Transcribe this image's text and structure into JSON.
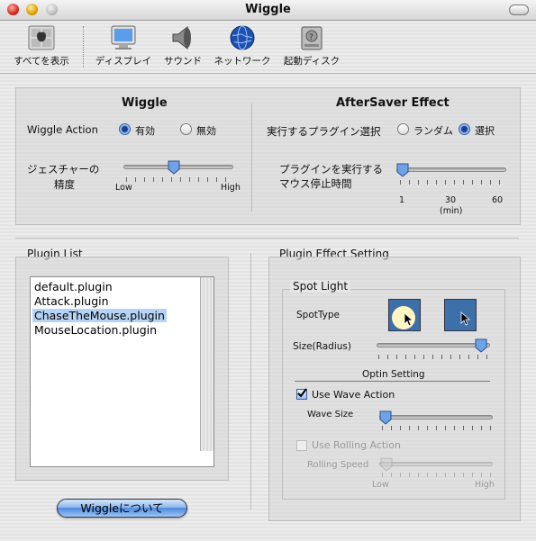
{
  "window": {
    "title": "Wiggle"
  },
  "toolbar": {
    "items": [
      {
        "label": "すべてを表示",
        "icon": "apple-icon"
      },
      {
        "label": "ディスプレイ",
        "icon": "display-icon"
      },
      {
        "label": "サウンド",
        "icon": "speaker-icon"
      },
      {
        "label": "ネットワーク",
        "icon": "globe-icon"
      },
      {
        "label": "起動ディスク",
        "icon": "disk-icon"
      }
    ]
  },
  "wiggle": {
    "title": "Wiggle",
    "action_label": "Wiggle Action",
    "opt_on": "有効",
    "opt_off": "無効",
    "selected": "有効",
    "gesture_label_1": "ジェスチャーの",
    "gesture_label_2": "精度",
    "slider_low": "Low",
    "slider_high": "High",
    "gesture_level": 0.45
  },
  "aftersaver": {
    "title": "AfterSaver Effect",
    "plugin_select_label": "実行するプラグイン選択",
    "opt_random": "ランダム",
    "opt_select": "選択",
    "selected": "選択",
    "idle_label_1": "プラグインを実行する",
    "idle_label_2": "マウス停止時間",
    "tick_1": "1",
    "tick_30": "30",
    "tick_60": "60",
    "unit": "(min)",
    "idle_minutes": 1
  },
  "plugin_list": {
    "title": "Plugin List",
    "items": [
      "default.plugin",
      "Attack.plugin",
      "ChaseTheMouse.plugin",
      "MouseLocation.plugin"
    ],
    "selected_index": 2
  },
  "effect": {
    "title": "Plugin Effect Setting",
    "spot_light": "Spot Light",
    "spot_type_label": "SpotType",
    "size_label": "Size(Radius)",
    "size_level": 0.97,
    "option_setting": "Optin Setting",
    "wave_action_label": "Use Wave Action",
    "wave_action_checked": true,
    "wave_size_label": "Wave Size",
    "wave_level": 0.0,
    "rolling_action_label": "Use Rolling Action",
    "rolling_action_checked": false,
    "rolling_speed_label": "Rolling Speed",
    "rolling_low": "Low",
    "rolling_high": "High"
  },
  "about_button": {
    "label": "Wiggleについて"
  },
  "colors": {
    "accent": "#3a6fd0",
    "selection": "#b5d3f5",
    "spot_yellow": "#fff6c0"
  }
}
